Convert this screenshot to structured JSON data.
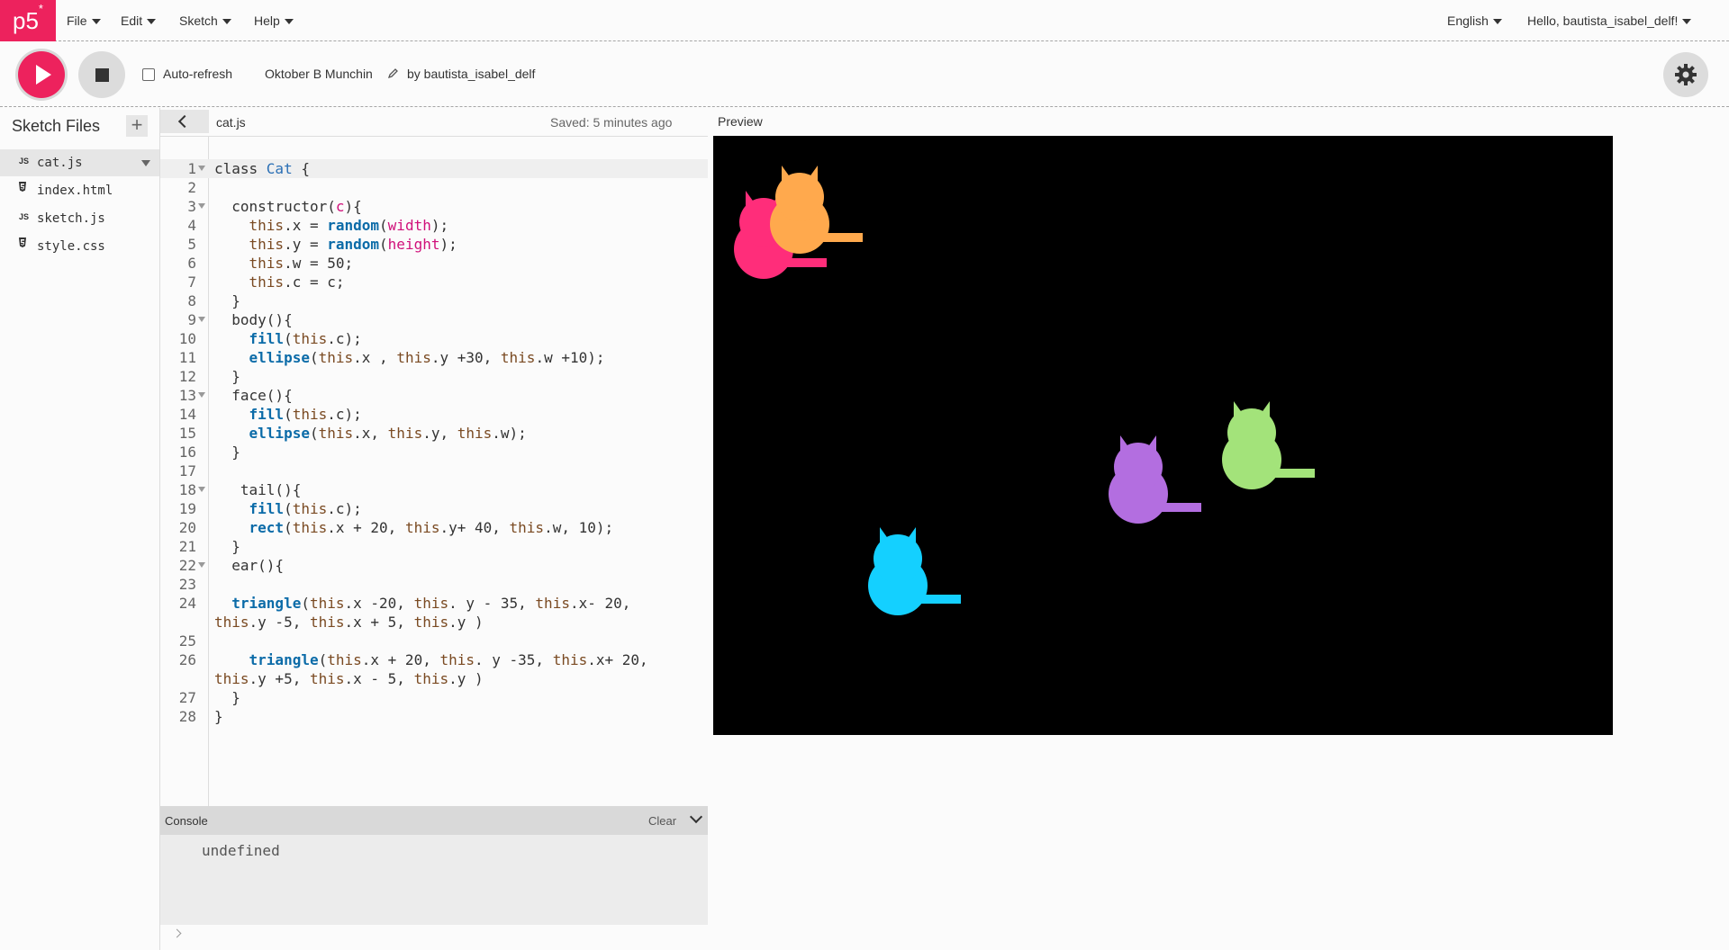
{
  "app": {
    "logo": "p5",
    "logo_star": "*"
  },
  "nav": {
    "menus": [
      "File",
      "Edit",
      "Sketch",
      "Help"
    ],
    "language": "English",
    "user_greeting": "Hello, bautista_isabel_delf!"
  },
  "toolbar": {
    "auto_refresh_label": "Auto-refresh",
    "auto_refresh_checked": false,
    "sketch_name": "Oktober B Munchin",
    "author": "by bautista_isabel_delf"
  },
  "sidebar": {
    "title": "Sketch Files",
    "files": [
      {
        "name": "cat.js",
        "icon": "JS",
        "active": true
      },
      {
        "name": "index.html",
        "icon": "html-file-icon",
        "active": false
      },
      {
        "name": "sketch.js",
        "icon": "JS",
        "active": false
      },
      {
        "name": "style.css",
        "icon": "css-file-icon",
        "active": false
      }
    ]
  },
  "editor": {
    "file_name": "cat.js",
    "saved_status": "Saved: 5 minutes ago",
    "preview_label": "Preview",
    "lines": [
      {
        "n": "1",
        "code": "class Cat {",
        "fold": true
      },
      {
        "n": "2",
        "code": ""
      },
      {
        "n": "3",
        "code": "  constructor(c){",
        "fold": true
      },
      {
        "n": "4",
        "code": "    this.x = random(width);"
      },
      {
        "n": "5",
        "code": "    this.y = random(height);"
      },
      {
        "n": "6",
        "code": "    this.w = 50;"
      },
      {
        "n": "7",
        "code": "    this.c = c;"
      },
      {
        "n": "8",
        "code": "  }"
      },
      {
        "n": "9",
        "code": "  body(){",
        "fold": true
      },
      {
        "n": "10",
        "code": "    fill(this.c);"
      },
      {
        "n": "11",
        "code": "    ellipse(this.x , this.y +30, this.w +10);"
      },
      {
        "n": "12",
        "code": "  }"
      },
      {
        "n": "13",
        "code": "  face(){",
        "fold": true
      },
      {
        "n": "14",
        "code": "    fill(this.c);"
      },
      {
        "n": "15",
        "code": "    ellipse(this.x, this.y, this.w);"
      },
      {
        "n": "16",
        "code": "  }"
      },
      {
        "n": "17",
        "code": ""
      },
      {
        "n": "18",
        "code": "   tail(){",
        "fold": true
      },
      {
        "n": "19",
        "code": "    fill(this.c);"
      },
      {
        "n": "20",
        "code": "    rect(this.x + 20, this.y+ 40, this.w, 10);"
      },
      {
        "n": "21",
        "code": "  }"
      },
      {
        "n": "22",
        "code": "  ear(){",
        "fold": true
      },
      {
        "n": "23",
        "code": ""
      },
      {
        "n": "24",
        "code": "  triangle(this.x -20, this. y - 35, this.x- 20,",
        "wrap": "this.y -5, this.x + 5, this.y )"
      },
      {
        "n": "25",
        "code": ""
      },
      {
        "n": "26",
        "code": "    triangle(this.x + 20, this. y -35, this.x+ 20,",
        "wrap": "this.y +5, this.x - 5, this.y )"
      },
      {
        "n": "27",
        "code": "  }"
      },
      {
        "n": "28",
        "code": "}"
      }
    ]
  },
  "console": {
    "title": "Console",
    "clear_label": "Clear",
    "output": "undefined"
  },
  "preview": {
    "background": "#000000",
    "cats": [
      {
        "color": "#ff2d7a"
      },
      {
        "color": "#ffa94d"
      },
      {
        "color": "#b36ee0"
      },
      {
        "color": "#a3e37a"
      },
      {
        "color": "#14d0ff"
      }
    ]
  },
  "colors": {
    "accent": "#ed225d"
  }
}
